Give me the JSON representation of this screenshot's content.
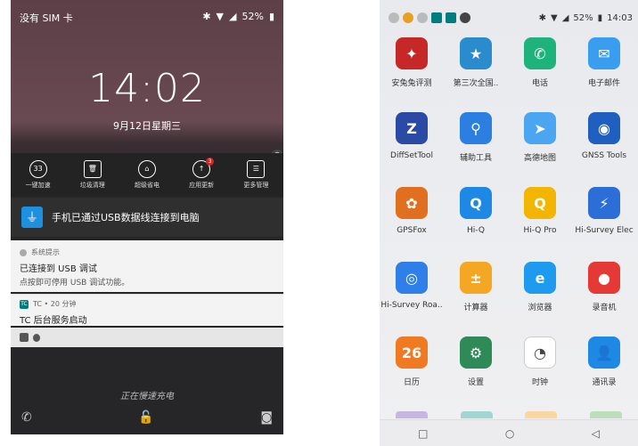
{
  "left_phone": {
    "status": {
      "carrier": "没有 SIM 卡",
      "battery": "52%"
    },
    "lock_time": "14:02",
    "lock_date": "9月12日星期三",
    "quick_actions": [
      {
        "label": "一键加速",
        "icon_text": "33",
        "icon": "speed-icon"
      },
      {
        "label": "垃圾清理",
        "icon_text": "🗑",
        "icon": "trash-icon"
      },
      {
        "label": "超级省电",
        "icon_text": "⌂",
        "icon": "battery-save-icon"
      },
      {
        "label": "应用更新",
        "icon_text": "↑",
        "icon": "update-icon",
        "badge": "3"
      },
      {
        "label": "更多管理",
        "icon_text": "☰",
        "icon": "more-manage-icon"
      }
    ],
    "usb_notification": "手机已通过USB数据线连接到电脑",
    "system_notification": {
      "app": "系统提示",
      "title": "已连接到 USB 调试",
      "subtitle": "点按即可停用 USB 调试功能。"
    },
    "tc_notification": {
      "app_meta": "TC • 20 分钟",
      "title": "TC 后台服务启动"
    },
    "charging_text": "正在慢速充电"
  },
  "right_phone": {
    "status": {
      "battery": "52%",
      "time": "14:03"
    },
    "apps": [
      {
        "label": "安兔兔评测",
        "color": "#c62828",
        "glyph": "✦",
        "icon": "antutu-icon"
      },
      {
        "label": "第三次全国..",
        "color": "#2b8ccd",
        "glyph": "★",
        "icon": "census-icon"
      },
      {
        "label": "电话",
        "color": "#1fb37c",
        "glyph": "✆",
        "icon": "phone-icon"
      },
      {
        "label": "电子邮件",
        "color": "#3a9ef0",
        "glyph": "✉",
        "icon": "email-icon"
      },
      {
        "label": "DiffSetTool",
        "color": "#2a4aa6",
        "glyph": "Z",
        "icon": "diffsettool-icon"
      },
      {
        "label": "辅助工具",
        "color": "#2a7fe0",
        "glyph": "⚲",
        "icon": "assist-tool-icon"
      },
      {
        "label": "高德地图",
        "color": "#4aa6f0",
        "glyph": "➤",
        "icon": "amap-icon"
      },
      {
        "label": "GNSS Tools",
        "color": "#1f5fbf",
        "glyph": "◉",
        "icon": "gnss-tools-icon"
      },
      {
        "label": "GPSFox",
        "color": "#e0701f",
        "glyph": "✿",
        "icon": "gpsfox-icon"
      },
      {
        "label": "Hi-Q",
        "color": "#1e88e5",
        "glyph": "Q",
        "icon": "hiq-icon"
      },
      {
        "label": "Hi-Q Pro",
        "color": "#f2b500",
        "glyph": "Q",
        "icon": "hiq-pro-icon"
      },
      {
        "label": "Hi-Survey Elec",
        "color": "#2b6fd6",
        "glyph": "⚡",
        "icon": "hisurvey-elec-icon"
      },
      {
        "label": "Hi-Survey Roa..",
        "color": "#2f7fe8",
        "glyph": "◎",
        "icon": "hisurvey-road-icon"
      },
      {
        "label": "计算器",
        "color": "#f5a623",
        "glyph": "±",
        "icon": "calculator-icon"
      },
      {
        "label": "浏览器",
        "color": "#1e9bef",
        "glyph": "e",
        "icon": "browser-icon"
      },
      {
        "label": "录音机",
        "color": "#e53935",
        "glyph": "●",
        "icon": "recorder-icon"
      },
      {
        "label": "日历",
        "color": "#f07a22",
        "glyph": "26",
        "icon": "calendar-icon"
      },
      {
        "label": "设置",
        "color": "#2e8b57",
        "glyph": "⚙",
        "icon": "settings-icon"
      },
      {
        "label": "时钟",
        "color": "#ffffff",
        "glyph": "◔",
        "icon": "clock-icon"
      },
      {
        "label": "通讯录",
        "color": "#1e88e5",
        "glyph": "👤",
        "icon": "contacts-icon"
      }
    ],
    "nav": {
      "recent": "□",
      "home": "○",
      "back": "◁"
    }
  }
}
